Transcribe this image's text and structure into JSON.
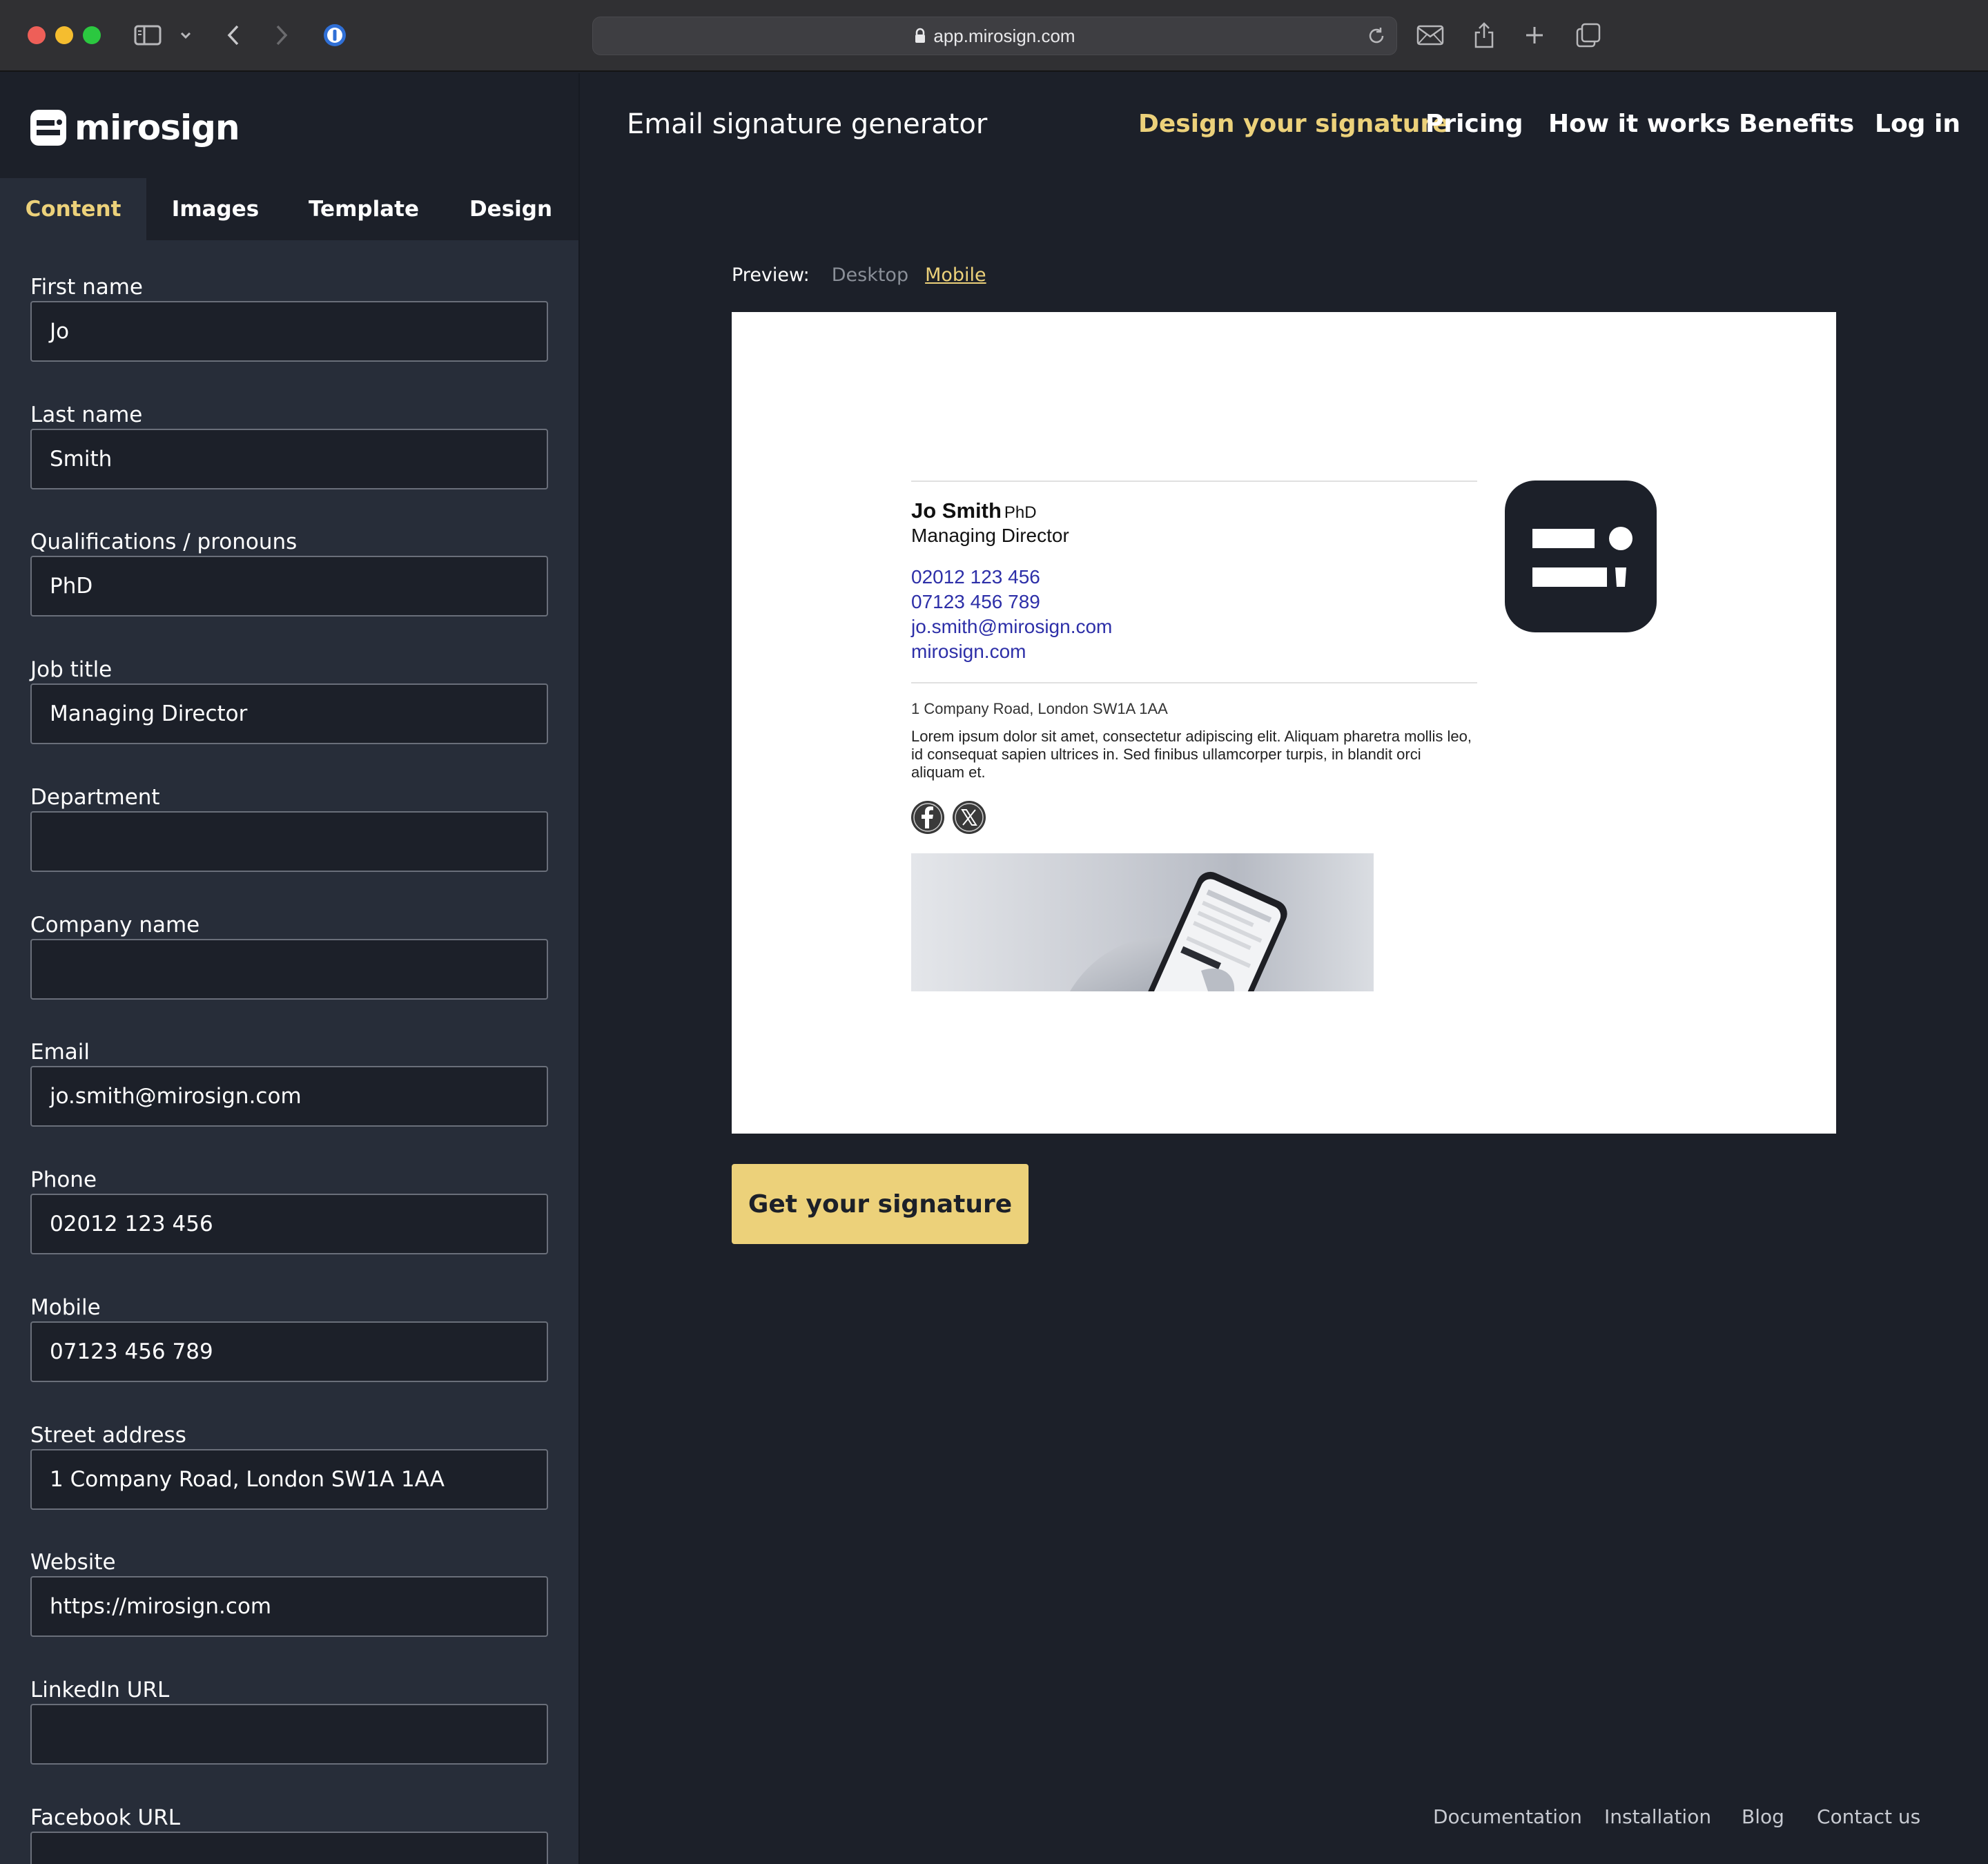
{
  "browser": {
    "url": "app.mirosign.com"
  },
  "brand": {
    "name": "mirosign"
  },
  "sidebar": {
    "tabs": [
      "Content",
      "Images",
      "Template",
      "Design"
    ],
    "active_tab": "Content",
    "fields": [
      {
        "label": "First name",
        "value": "Jo"
      },
      {
        "label": "Last name",
        "value": "Smith"
      },
      {
        "label": "Qualifications / pronouns",
        "value": "PhD"
      },
      {
        "label": "Job title",
        "value": "Managing Director"
      },
      {
        "label": "Department",
        "value": ""
      },
      {
        "label": "Company name",
        "value": ""
      },
      {
        "label": "Email",
        "value": "jo.smith@mirosign.com"
      },
      {
        "label": "Phone",
        "value": "02012 123 456"
      },
      {
        "label": "Mobile",
        "value": "07123 456 789"
      },
      {
        "label": "Street address",
        "value": "1 Company Road, London SW1A 1AA"
      },
      {
        "label": "Website",
        "value": "https://mirosign.com"
      },
      {
        "label": "LinkedIn URL",
        "value": ""
      },
      {
        "label": "Facebook URL",
        "value": ""
      }
    ]
  },
  "header": {
    "title": "Email signature generator",
    "nav": [
      "Design your signature",
      "Pricing",
      "How it works",
      "Benefits",
      "Log in"
    ],
    "active_nav": "Design your signature"
  },
  "preview": {
    "label": "Preview:",
    "modes": [
      "Desktop",
      "Mobile"
    ],
    "active_mode": "Mobile"
  },
  "signature": {
    "name": "Jo Smith",
    "qualification": "PhD",
    "job_title": "Managing Director",
    "phone": "02012 123 456",
    "mobile": "07123 456 789",
    "email": "jo.smith@mirosign.com",
    "website": "mirosign.com",
    "address": "1 Company Road, London SW1A 1AA",
    "disclaimer": "Lorem ipsum dolor sit amet, consectetur adipiscing elit. Aliquam pharetra mollis leo, id consequat sapien ultrices in. Sed finibus ullamcorper turpis, in blandit orci aliquam et.",
    "social_icons": [
      "facebook-icon",
      "x-icon"
    ]
  },
  "cta": {
    "label": "Get your signature"
  },
  "footer": {
    "links": [
      "Documentation",
      "Installation",
      "Blog",
      "Contact us"
    ]
  },
  "colors": {
    "accent": "#ecd17a",
    "background": "#1c2029",
    "sidebar": "#272d39",
    "link": "#2d2fa8"
  }
}
